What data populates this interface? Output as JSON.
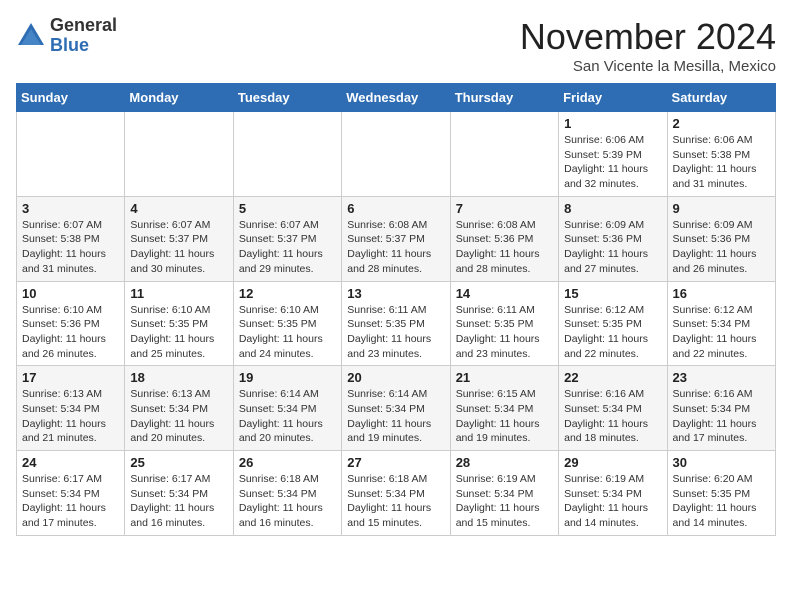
{
  "logo": {
    "general": "General",
    "blue": "Blue"
  },
  "header": {
    "month_title": "November 2024",
    "location": "San Vicente la Mesilla, Mexico"
  },
  "days_of_week": [
    "Sunday",
    "Monday",
    "Tuesday",
    "Wednesday",
    "Thursday",
    "Friday",
    "Saturday"
  ],
  "weeks": [
    [
      {
        "day": "",
        "info": ""
      },
      {
        "day": "",
        "info": ""
      },
      {
        "day": "",
        "info": ""
      },
      {
        "day": "",
        "info": ""
      },
      {
        "day": "",
        "info": ""
      },
      {
        "day": "1",
        "info": "Sunrise: 6:06 AM\nSunset: 5:39 PM\nDaylight: 11 hours and 32 minutes."
      },
      {
        "day": "2",
        "info": "Sunrise: 6:06 AM\nSunset: 5:38 PM\nDaylight: 11 hours and 31 minutes."
      }
    ],
    [
      {
        "day": "3",
        "info": "Sunrise: 6:07 AM\nSunset: 5:38 PM\nDaylight: 11 hours and 31 minutes."
      },
      {
        "day": "4",
        "info": "Sunrise: 6:07 AM\nSunset: 5:37 PM\nDaylight: 11 hours and 30 minutes."
      },
      {
        "day": "5",
        "info": "Sunrise: 6:07 AM\nSunset: 5:37 PM\nDaylight: 11 hours and 29 minutes."
      },
      {
        "day": "6",
        "info": "Sunrise: 6:08 AM\nSunset: 5:37 PM\nDaylight: 11 hours and 28 minutes."
      },
      {
        "day": "7",
        "info": "Sunrise: 6:08 AM\nSunset: 5:36 PM\nDaylight: 11 hours and 28 minutes."
      },
      {
        "day": "8",
        "info": "Sunrise: 6:09 AM\nSunset: 5:36 PM\nDaylight: 11 hours and 27 minutes."
      },
      {
        "day": "9",
        "info": "Sunrise: 6:09 AM\nSunset: 5:36 PM\nDaylight: 11 hours and 26 minutes."
      }
    ],
    [
      {
        "day": "10",
        "info": "Sunrise: 6:10 AM\nSunset: 5:36 PM\nDaylight: 11 hours and 26 minutes."
      },
      {
        "day": "11",
        "info": "Sunrise: 6:10 AM\nSunset: 5:35 PM\nDaylight: 11 hours and 25 minutes."
      },
      {
        "day": "12",
        "info": "Sunrise: 6:10 AM\nSunset: 5:35 PM\nDaylight: 11 hours and 24 minutes."
      },
      {
        "day": "13",
        "info": "Sunrise: 6:11 AM\nSunset: 5:35 PM\nDaylight: 11 hours and 23 minutes."
      },
      {
        "day": "14",
        "info": "Sunrise: 6:11 AM\nSunset: 5:35 PM\nDaylight: 11 hours and 23 minutes."
      },
      {
        "day": "15",
        "info": "Sunrise: 6:12 AM\nSunset: 5:35 PM\nDaylight: 11 hours and 22 minutes."
      },
      {
        "day": "16",
        "info": "Sunrise: 6:12 AM\nSunset: 5:34 PM\nDaylight: 11 hours and 22 minutes."
      }
    ],
    [
      {
        "day": "17",
        "info": "Sunrise: 6:13 AM\nSunset: 5:34 PM\nDaylight: 11 hours and 21 minutes."
      },
      {
        "day": "18",
        "info": "Sunrise: 6:13 AM\nSunset: 5:34 PM\nDaylight: 11 hours and 20 minutes."
      },
      {
        "day": "19",
        "info": "Sunrise: 6:14 AM\nSunset: 5:34 PM\nDaylight: 11 hours and 20 minutes."
      },
      {
        "day": "20",
        "info": "Sunrise: 6:14 AM\nSunset: 5:34 PM\nDaylight: 11 hours and 19 minutes."
      },
      {
        "day": "21",
        "info": "Sunrise: 6:15 AM\nSunset: 5:34 PM\nDaylight: 11 hours and 19 minutes."
      },
      {
        "day": "22",
        "info": "Sunrise: 6:16 AM\nSunset: 5:34 PM\nDaylight: 11 hours and 18 minutes."
      },
      {
        "day": "23",
        "info": "Sunrise: 6:16 AM\nSunset: 5:34 PM\nDaylight: 11 hours and 17 minutes."
      }
    ],
    [
      {
        "day": "24",
        "info": "Sunrise: 6:17 AM\nSunset: 5:34 PM\nDaylight: 11 hours and 17 minutes."
      },
      {
        "day": "25",
        "info": "Sunrise: 6:17 AM\nSunset: 5:34 PM\nDaylight: 11 hours and 16 minutes."
      },
      {
        "day": "26",
        "info": "Sunrise: 6:18 AM\nSunset: 5:34 PM\nDaylight: 11 hours and 16 minutes."
      },
      {
        "day": "27",
        "info": "Sunrise: 6:18 AM\nSunset: 5:34 PM\nDaylight: 11 hours and 15 minutes."
      },
      {
        "day": "28",
        "info": "Sunrise: 6:19 AM\nSunset: 5:34 PM\nDaylight: 11 hours and 15 minutes."
      },
      {
        "day": "29",
        "info": "Sunrise: 6:19 AM\nSunset: 5:34 PM\nDaylight: 11 hours and 14 minutes."
      },
      {
        "day": "30",
        "info": "Sunrise: 6:20 AM\nSunset: 5:35 PM\nDaylight: 11 hours and 14 minutes."
      }
    ]
  ]
}
